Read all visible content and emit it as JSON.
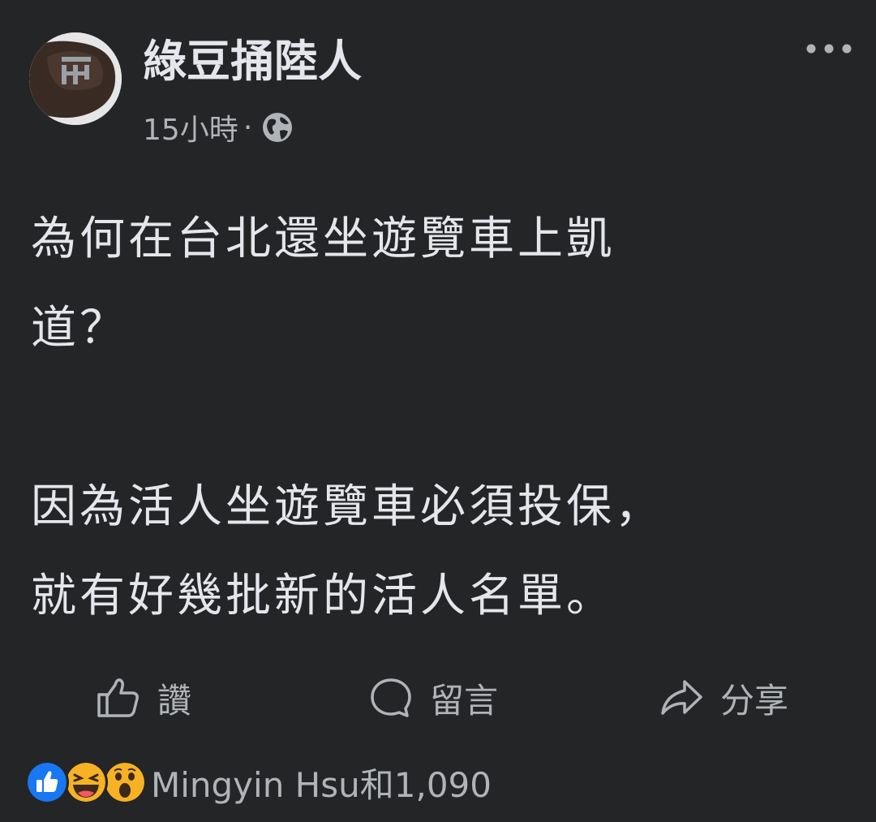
{
  "post": {
    "author": "綠豆捅陸人",
    "timestamp": "15小時",
    "separator": "·",
    "privacy_icon": "globe-icon",
    "body_lines": [
      "為何在台北還坐遊覽車上凱",
      "道？",
      "因為活人坐遊覽車必須投保，",
      "就有好幾批新的活人名單。"
    ]
  },
  "actions": {
    "like_label": "讚",
    "comment_label": "留言",
    "share_label": "分享"
  },
  "reactions": {
    "icons": [
      "like-reaction-icon",
      "haha-reaction-icon",
      "wow-reaction-icon"
    ],
    "summary": "Mingyin Hsu和1,090"
  },
  "colors": {
    "background": "#242526",
    "primary_text": "#e4e6eb",
    "secondary_text": "#b0b3b8",
    "like_blue": "#1877f2",
    "reaction_yellow": "#f7b125"
  }
}
